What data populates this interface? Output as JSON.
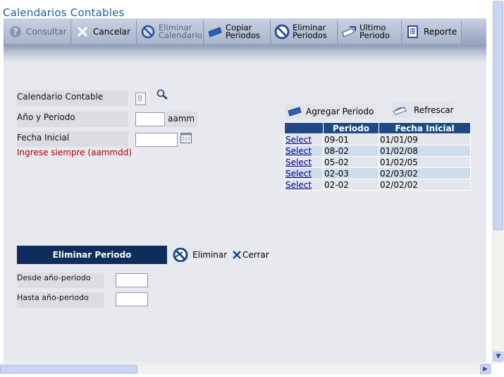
{
  "app": {
    "title": "Calendarios Contables"
  },
  "toolbar": {
    "consultar": "Consultar",
    "cancelar": "Cancelar",
    "eliminar_calendario_1": "Eliminar",
    "eliminar_calendario_2": "Calendario",
    "copiar_periodos_1": "Copiar",
    "copiar_periodos_2": "Periodos",
    "eliminar_periodos_1": "Eliminar",
    "eliminar_periodos_2": "Periodos",
    "ultimo_periodo_1": "Ultimo",
    "ultimo_periodo_2": "Periodo",
    "reporte": "Reporte"
  },
  "form": {
    "calendario_label": "Calendario Contable",
    "calendario_value": "8",
    "anio_periodo_label": "Año y Periodo",
    "anio_periodo_value": "",
    "anio_periodo_suffix": "aamm",
    "fecha_inicial_label": "Fecha Inicial",
    "fecha_inicial_value": "",
    "hint": "Ingrese siempre (aammdd)"
  },
  "grid_actions": {
    "agregar": "Agregar Periodo",
    "refrescar": "Refrescar"
  },
  "grid": {
    "headers": [
      "",
      "Periodo",
      "Fecha Inicial"
    ],
    "rows": [
      {
        "action": "Select",
        "periodo": "09-01",
        "fecha": "01/01/09"
      },
      {
        "action": "Select",
        "periodo": "08-02",
        "fecha": "01/02/08"
      },
      {
        "action": "Select",
        "periodo": "05-02",
        "fecha": "01/02/05"
      },
      {
        "action": "Select",
        "periodo": "02-03",
        "fecha": "02/03/02"
      },
      {
        "action": "Select",
        "periodo": "02-02",
        "fecha": "02/02/02"
      }
    ]
  },
  "delete_section": {
    "title": "Eliminar Periodo",
    "eliminar": "Eliminar",
    "cerrar": "Cerrar",
    "desde_label": "Desde año-periodo",
    "desde_value": "",
    "hasta_label": "Hasta año-periodo",
    "hasta_value": ""
  },
  "colors": {
    "header_blue": "#0e2c5c",
    "grid_header": "#1f4a86",
    "hint_red": "#b00000",
    "title_blue": "#1a5fa8"
  }
}
